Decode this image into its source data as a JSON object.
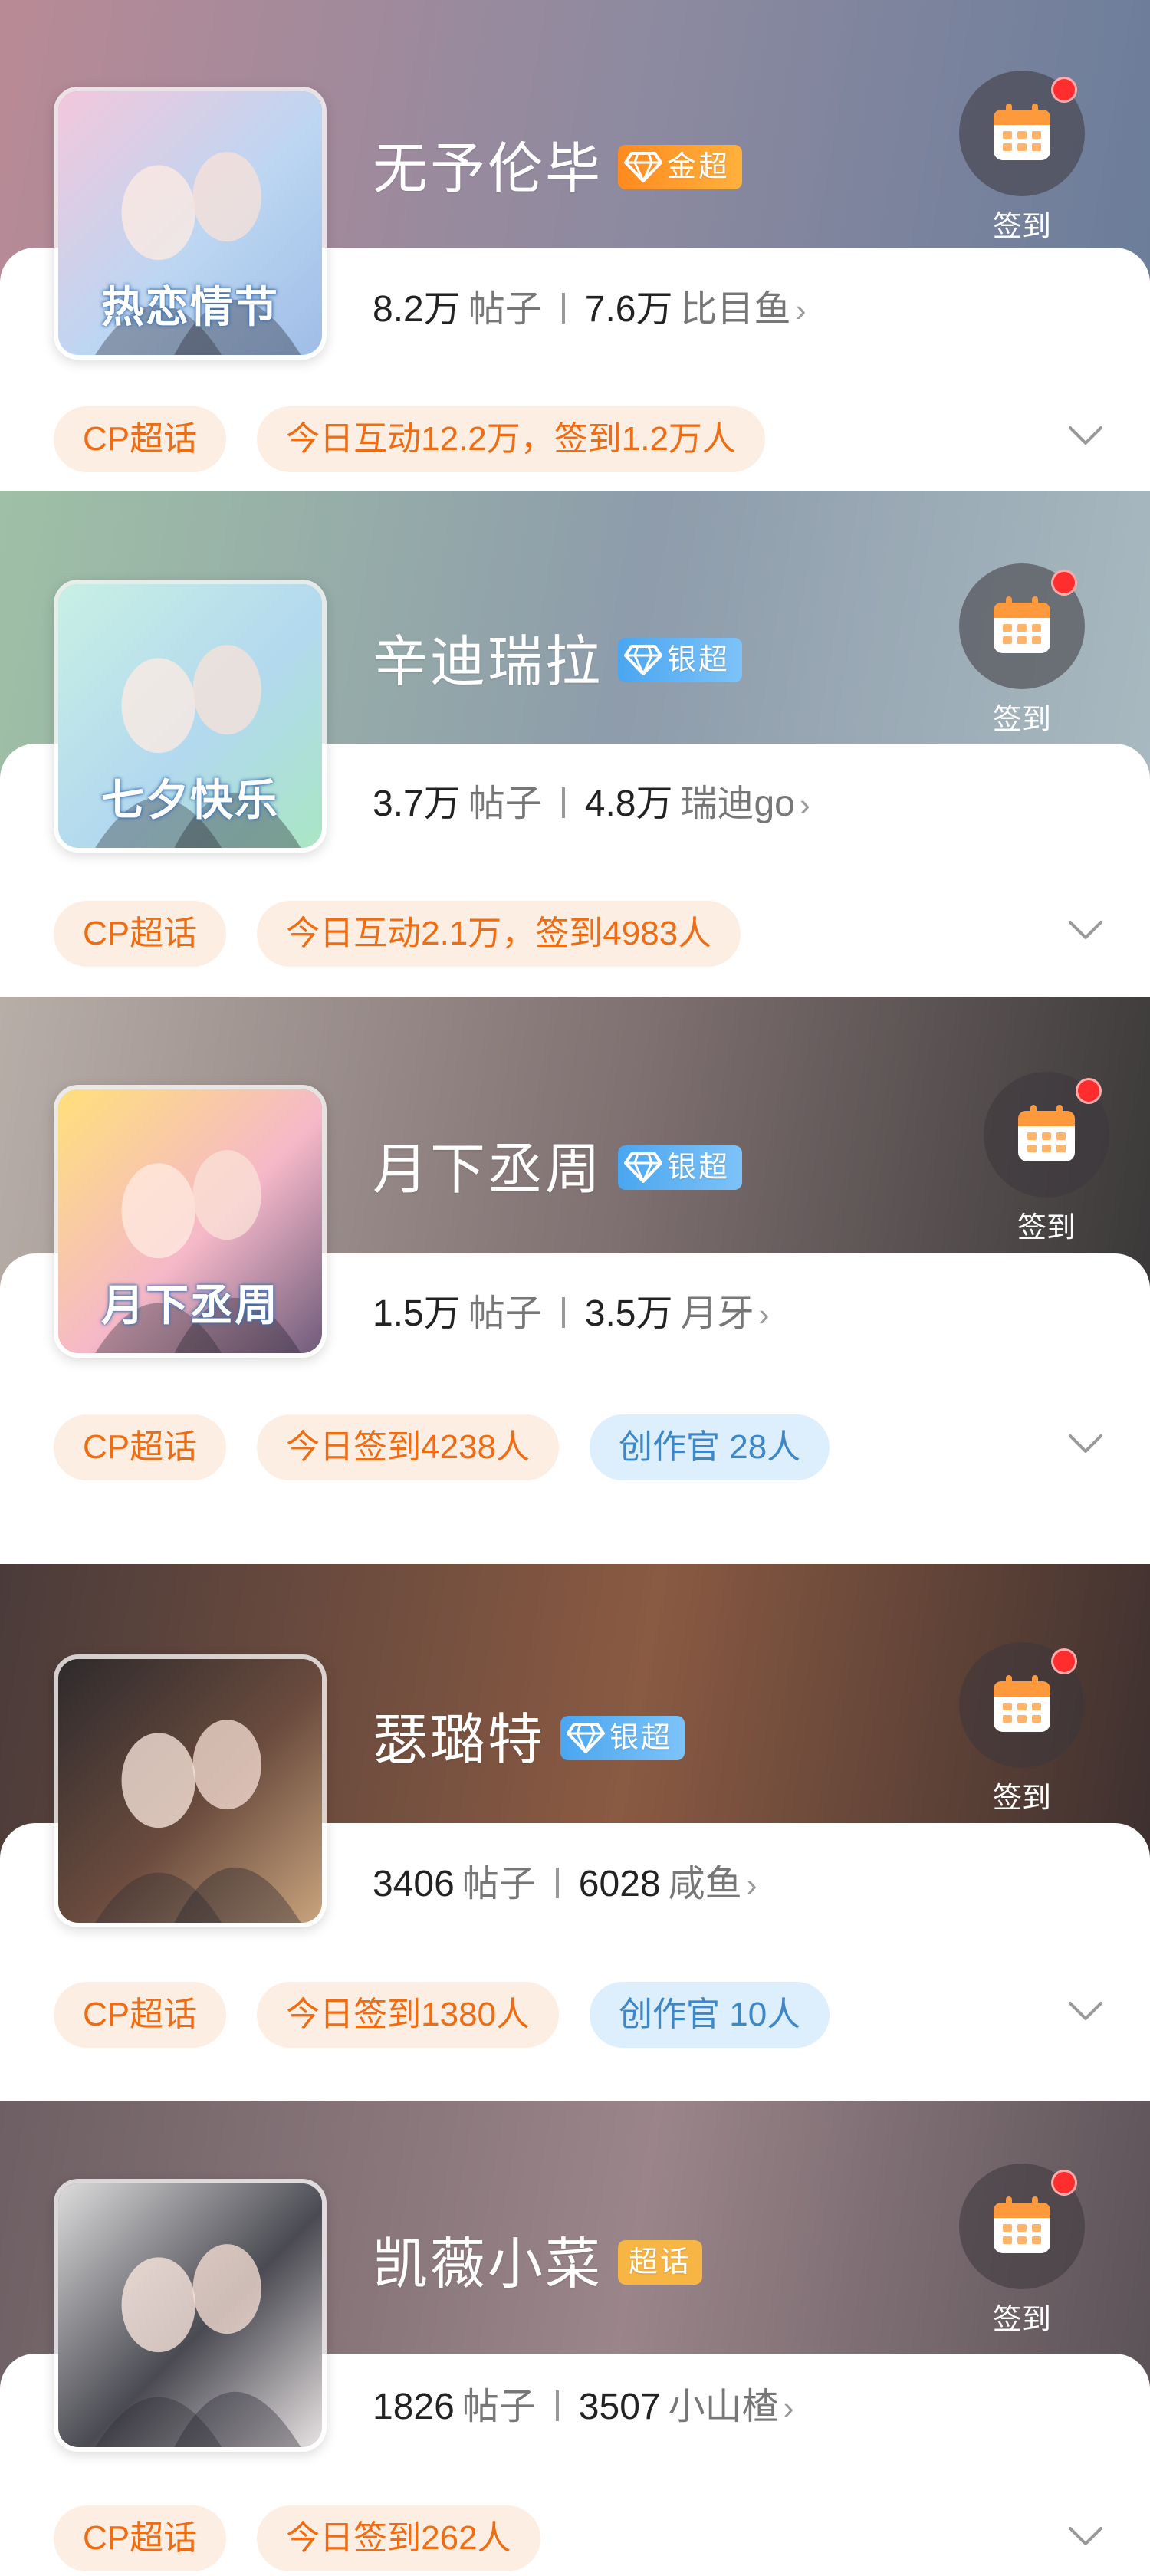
{
  "checkin_label": "签到",
  "posts_label": "帖子",
  "cards": [
    {
      "title": "无予伦毕",
      "badge": {
        "type": "gold",
        "text": "金超",
        "icon": "diamond-icon"
      },
      "cover_text": "热恋情节",
      "posts": "8.2万",
      "fans": "7.6万",
      "fan_name": "比目鱼",
      "chips": [
        {
          "text": "CP超话",
          "color": "orange"
        },
        {
          "text": "今日互动12.2万，签到1.2万人",
          "color": "orange"
        }
      ],
      "banner_colors": [
        "#b98a96",
        "#8d8aa0",
        "#6b7d9a"
      ]
    },
    {
      "title": "辛迪瑞拉",
      "badge": {
        "type": "silver",
        "text": "银超",
        "icon": "diamond-icon"
      },
      "cover_text": "七夕快乐",
      "posts": "3.7万",
      "fans": "4.8万",
      "fan_name": "瑞迪go",
      "chips": [
        {
          "text": "CP超话",
          "color": "orange"
        },
        {
          "text": "今日互动2.1万，签到4983人",
          "color": "orange"
        }
      ],
      "banner_colors": [
        "#9fc0a6",
        "#8e9cab",
        "#a8b9c0"
      ]
    },
    {
      "title": "月下丞周",
      "badge": {
        "type": "silver",
        "text": "银超",
        "icon": "diamond-icon"
      },
      "cover_text": "月下丞周",
      "posts": "1.5万",
      "fans": "3.5万",
      "fan_name": "月牙",
      "chips": [
        {
          "text": "CP超话",
          "color": "orange"
        },
        {
          "text": "今日签到4238人",
          "color": "orange"
        },
        {
          "text": "创作官 28人",
          "color": "blue"
        }
      ],
      "banner_colors": [
        "#b8aea8",
        "#7e6f70",
        "#3a3838"
      ]
    },
    {
      "title": "瑟璐特",
      "badge": {
        "type": "silver",
        "text": "银超",
        "icon": "diamond-icon"
      },
      "cover_text": "",
      "posts": "3406",
      "fans": "6028",
      "fan_name": "咸鱼",
      "chips": [
        {
          "text": "CP超话",
          "color": "orange"
        },
        {
          "text": "今日签到1380人",
          "color": "orange"
        },
        {
          "text": "创作官 10人",
          "color": "blue"
        }
      ],
      "banner_colors": [
        "#4a3b3a",
        "#8a5a42",
        "#3d302f"
      ]
    },
    {
      "title": "凯薇小菜",
      "badge": {
        "type": "plain",
        "text": "超话",
        "icon": ""
      },
      "cover_text": "",
      "posts": "1826",
      "fans": "3507",
      "fan_name": "小山楂",
      "chips": [
        {
          "text": "CP超话",
          "color": "orange"
        },
        {
          "text": "今日签到262人",
          "color": "orange"
        }
      ],
      "banner_colors": [
        "#6d5f63",
        "#9a858a",
        "#5b5257"
      ]
    }
  ]
}
